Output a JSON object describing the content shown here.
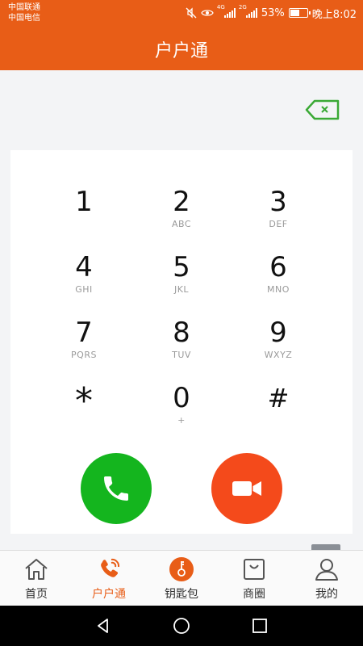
{
  "status_bar": {
    "carrier_1": "中国联通",
    "carrier_2": "中国电信",
    "sig1_tag": "4G",
    "sig2_tag": "2G",
    "battery": "53%",
    "time": "晚上8:02"
  },
  "header": {
    "title": "户户通"
  },
  "keypad": {
    "keys": [
      {
        "num": "1",
        "sub": ""
      },
      {
        "num": "2",
        "sub": "ABC"
      },
      {
        "num": "3",
        "sub": "DEF"
      },
      {
        "num": "4",
        "sub": "GHI"
      },
      {
        "num": "5",
        "sub": "JKL"
      },
      {
        "num": "6",
        "sub": "MNO"
      },
      {
        "num": "7",
        "sub": "PQRS"
      },
      {
        "num": "8",
        "sub": "TUV"
      },
      {
        "num": "9",
        "sub": "WXYZ"
      },
      {
        "num": "*",
        "sub": ""
      },
      {
        "num": "0",
        "sub": "+"
      },
      {
        "num": "#",
        "sub": ""
      }
    ]
  },
  "bottom_nav": {
    "items": [
      {
        "label": "首页",
        "icon": "home-icon"
      },
      {
        "label": "户户通",
        "icon": "phone-call-icon"
      },
      {
        "label": "钥匙包",
        "icon": "key-icon"
      },
      {
        "label": "商圈",
        "icon": "shopping-bag-icon"
      },
      {
        "label": "我的",
        "icon": "user-icon"
      }
    ],
    "active_index": 1
  },
  "colors": {
    "accent": "#e85d17",
    "voice_call": "#14b51e",
    "video_call": "#f44a1b",
    "backspace": "#3aa935"
  }
}
